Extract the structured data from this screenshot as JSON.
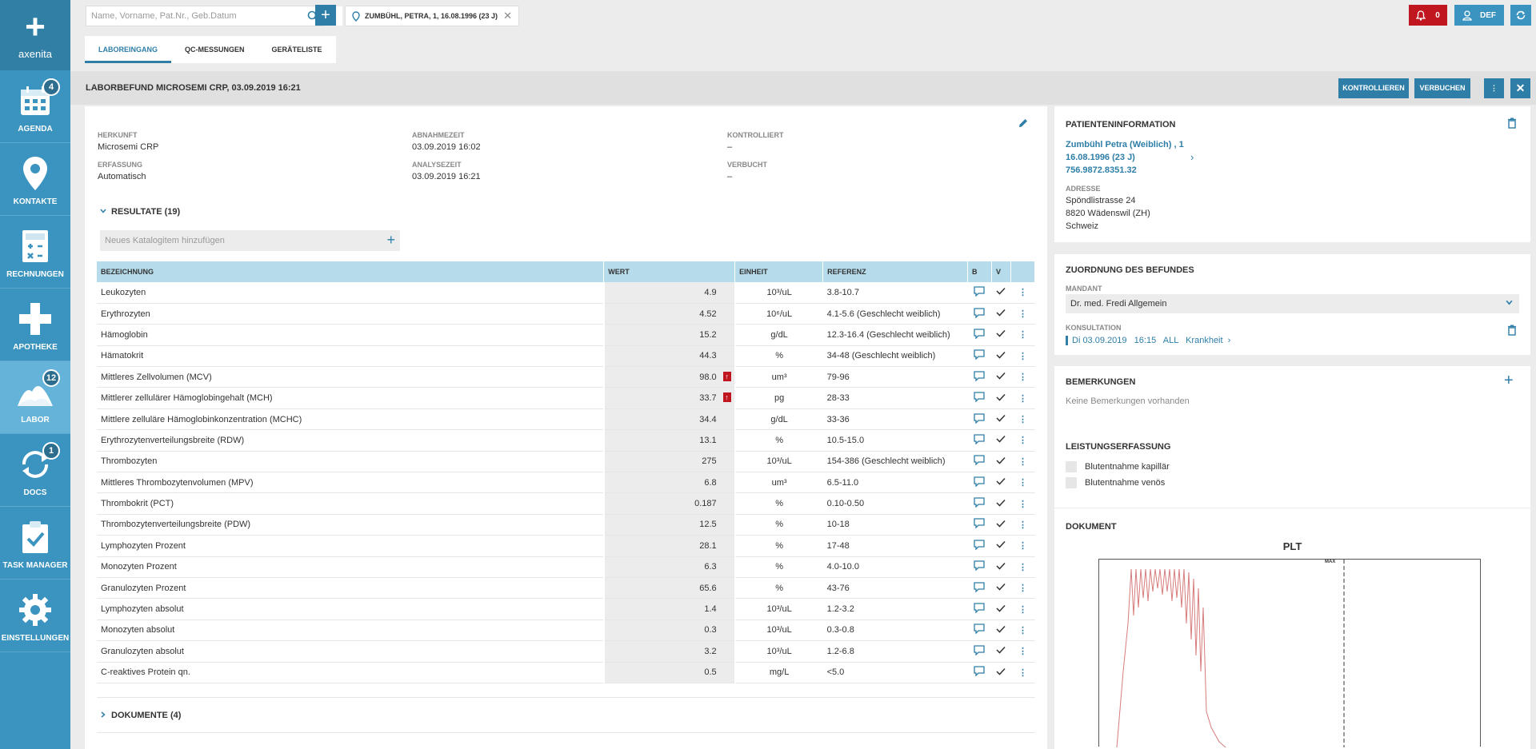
{
  "app": {
    "brand": "axenita"
  },
  "sidebar": {
    "items": [
      {
        "label": "AGENDA",
        "badge": "4",
        "icon": "calendar-icon"
      },
      {
        "label": "KONTAKTE",
        "badge": "",
        "icon": "location-pin-icon"
      },
      {
        "label": "RECHNUNGEN",
        "badge": "",
        "icon": "calculator-icon"
      },
      {
        "label": "APOTHEKE",
        "badge": "",
        "icon": "cross-icon"
      },
      {
        "label": "LABOR",
        "badge": "12",
        "icon": "flask-icon"
      },
      {
        "label": "DOCS",
        "badge": "1",
        "icon": "sync-icon"
      },
      {
        "label": "TASK MANAGER",
        "badge": "",
        "icon": "clipboard-check-icon"
      },
      {
        "label": "EINSTELLUNGEN",
        "badge": "",
        "icon": "gear-icon"
      }
    ]
  },
  "topbar": {
    "search_placeholder": "Name, Vorname, Pat.Nr., Geb.Datum",
    "patient_tab": "ZUMBÜHL, PETRA, 1, 16.08.1996 (23 J)",
    "notifications_count": "0",
    "user": "DEF"
  },
  "tabs": [
    "LABOREINGANG",
    "QC-MESSUNGEN",
    "GERÄTELISTE"
  ],
  "header": {
    "title": "LABORBEFUND MICROSEMI CRP, 03.09.2019 16:21",
    "btn_check": "KONTROLLIEREN",
    "btn_book": "VERBUCHEN"
  },
  "meta": {
    "herkunft_label": "HERKUNFT",
    "herkunft": "Microsemi CRP",
    "erfassung_label": "ERFASSUNG",
    "erfassung": "Automatisch",
    "abnahme_label": "ABNAHMEZEIT",
    "abnahme": "03.09.2019 16:02",
    "analyse_label": "ANALYSEZEIT",
    "analyse": "03.09.2019 16:21",
    "kontrolliert_label": "KONTROLLIERT",
    "kontrolliert": "–",
    "verbucht_label": "VERBUCHT",
    "verbucht": "–"
  },
  "results": {
    "section_title": "RESULTATE (19)",
    "catalog_placeholder": "Neues Katalogitem hinzufügen",
    "columns": [
      "BEZEICHNUNG",
      "WERT",
      "EINHEIT",
      "REFERENZ",
      "B",
      "V"
    ],
    "rows": [
      {
        "name": "Leukozyten",
        "value": "4.9",
        "unit": "10³/uL",
        "ref": "3.8-10.7",
        "flag": ""
      },
      {
        "name": "Erythrozyten",
        "value": "4.52",
        "unit": "10⁶/uL",
        "ref": "4.1-5.6 (Geschlecht weiblich)",
        "flag": ""
      },
      {
        "name": "Hämoglobin",
        "value": "15.2",
        "unit": "g/dL",
        "ref": "12.3-16.4 (Geschlecht weiblich)",
        "flag": ""
      },
      {
        "name": "Hämatokrit",
        "value": "44.3",
        "unit": "%",
        "ref": "34-48 (Geschlecht weiblich)",
        "flag": ""
      },
      {
        "name": "Mittleres Zellvolumen (MCV)",
        "value": "98.0",
        "unit": "um³",
        "ref": "79-96",
        "flag": "↑"
      },
      {
        "name": "Mittlerer zellulärer Hämoglobingehalt (MCH)",
        "value": "33.7",
        "unit": "pg",
        "ref": "28-33",
        "flag": "↑"
      },
      {
        "name": "Mittlere zelluläre Hämoglobinkonzentration (MCHC)",
        "value": "34.4",
        "unit": "g/dL",
        "ref": "33-36",
        "flag": ""
      },
      {
        "name": "Erythrozytenverteilungsbreite (RDW)",
        "value": "13.1",
        "unit": "%",
        "ref": "10.5-15.0",
        "flag": ""
      },
      {
        "name": "Thrombozyten",
        "value": "275",
        "unit": "10³/uL",
        "ref": "154-386 (Geschlecht weiblich)",
        "flag": ""
      },
      {
        "name": "Mittleres Thrombozytenvolumen (MPV)",
        "value": "6.8",
        "unit": "um³",
        "ref": "6.5-11.0",
        "flag": ""
      },
      {
        "name": "Thrombokrit (PCT)",
        "value": "0.187",
        "unit": "%",
        "ref": "0.10-0.50",
        "flag": ""
      },
      {
        "name": "Thrombozytenverteilungsbreite (PDW)",
        "value": "12.5",
        "unit": "%",
        "ref": "10-18",
        "flag": ""
      },
      {
        "name": "Lymphozyten Prozent",
        "value": "28.1",
        "unit": "%",
        "ref": "17-48",
        "flag": ""
      },
      {
        "name": "Monozyten Prozent",
        "value": "6.3",
        "unit": "%",
        "ref": "4.0-10.0",
        "flag": ""
      },
      {
        "name": "Granulozyten Prozent",
        "value": "65.6",
        "unit": "%",
        "ref": "43-76",
        "flag": ""
      },
      {
        "name": "Lymphozyten absolut",
        "value": "1.4",
        "unit": "10³/uL",
        "ref": "1.2-3.2",
        "flag": ""
      },
      {
        "name": "Monozyten absolut",
        "value": "0.3",
        "unit": "10³/uL",
        "ref": "0.3-0.8",
        "flag": ""
      },
      {
        "name": "Granulozyten absolut",
        "value": "3.2",
        "unit": "10³/uL",
        "ref": "1.2-6.8",
        "flag": ""
      },
      {
        "name": "C-reaktives Protein qn.",
        "value": "0.5",
        "unit": "mg/L",
        "ref": "<5.0",
        "flag": ""
      }
    ]
  },
  "documents": {
    "section_title": "DOKUMENTE (4)"
  },
  "patient_info": {
    "title": "PATIENTENINFORMATION",
    "name_line": "Zumbühl Petra (Weiblich) , 1",
    "dob_line": "16.08.1996 (23 J)",
    "ahv": "756.9872.8351.32",
    "address_label": "ADRESSE",
    "street": "Spöndlistrasse 24",
    "city": "8820 Wädenswil (ZH)",
    "country": "Schweiz"
  },
  "assignment": {
    "title": "ZUORDNUNG DES BEFUNDES",
    "mandant_label": "MANDANT",
    "mandant": "Dr. med. Fredi Allgemein",
    "konsultation_label": "KONSULTATION",
    "konsultation": "Di 03.09.2019   16:15   ALL   Krankheit"
  },
  "remarks": {
    "title": "BEMERKUNGEN",
    "empty": "Keine Bemerkungen vorhanden"
  },
  "services": {
    "title": "LEISTUNGSERFASSUNG",
    "items": [
      "Blutentnahme kapillär",
      "Blutentnahme venös"
    ]
  },
  "document": {
    "title": "DOKUMENT",
    "chart_title": "PLT",
    "marker_label": "MAX"
  },
  "colors": {
    "primary": "#3b93bf",
    "accent": "#2e7ea8",
    "alert": "#c0161f",
    "table_header": "#b6dcec"
  }
}
